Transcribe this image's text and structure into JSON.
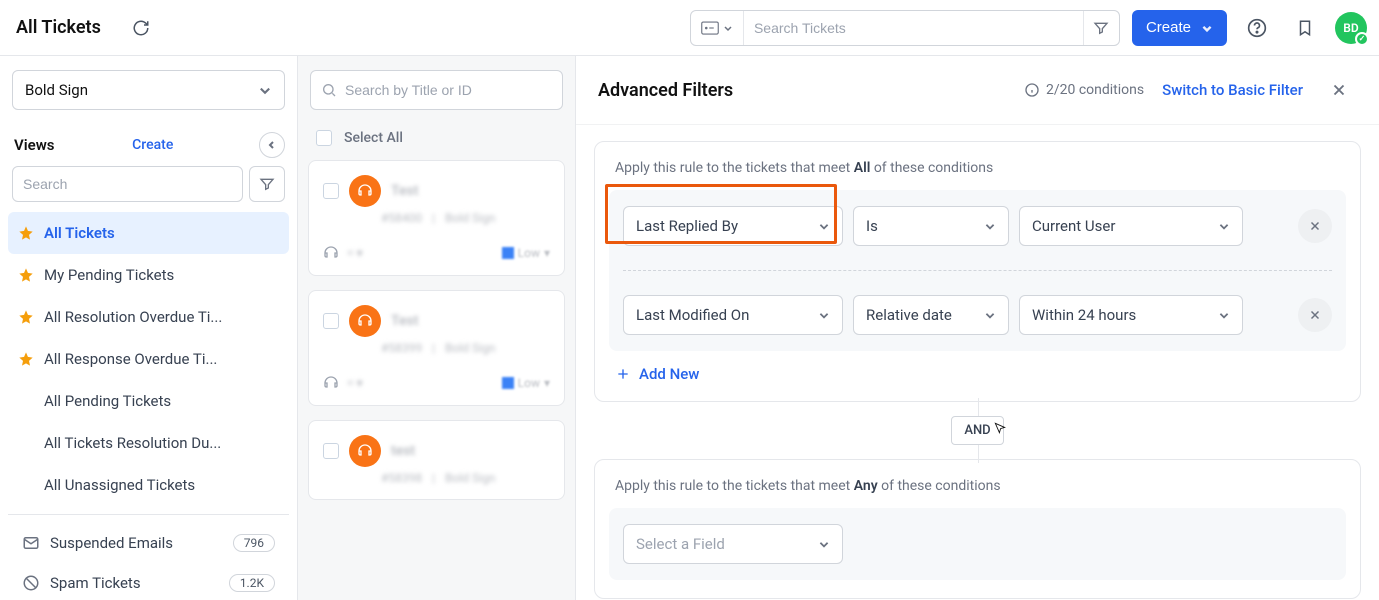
{
  "topbar": {
    "title": "All Tickets",
    "search_placeholder": "Search Tickets",
    "create_label": "Create",
    "avatar_initials": "BD"
  },
  "sidebar": {
    "product": "Bold Sign",
    "views_heading": "Views",
    "create_link": "Create",
    "search_placeholder": "Search",
    "items": [
      {
        "label": "All Tickets",
        "starred": true,
        "active": true
      },
      {
        "label": "My Pending Tickets",
        "starred": true,
        "active": false
      },
      {
        "label": "All Resolution Overdue Ti...",
        "starred": true,
        "active": false
      },
      {
        "label": "All Response Overdue Ti...",
        "starred": true,
        "active": false
      },
      {
        "label": "All Pending Tickets",
        "starred": false,
        "active": false
      },
      {
        "label": "All Tickets Resolution Du...",
        "starred": false,
        "active": false
      },
      {
        "label": "All Unassigned Tickets",
        "starred": false,
        "active": false
      }
    ],
    "special": [
      {
        "label": "Suspended Emails",
        "count": "796",
        "icon": "mail"
      },
      {
        "label": "Spam Tickets",
        "count": "1.2K",
        "icon": "spam"
      }
    ]
  },
  "tickets": {
    "search_placeholder": "Search by Title or ID",
    "select_all": "Select All",
    "cards": [
      {
        "title": "Test",
        "id": "#58400",
        "product": "Bold Sign",
        "priority": "Low"
      },
      {
        "title": "Test",
        "id": "#58399",
        "product": "Bold Sign",
        "priority": "Low"
      },
      {
        "title": "test",
        "id": "#58398",
        "product": "Bold Sign",
        "priority": "Low"
      }
    ]
  },
  "filters": {
    "title": "Advanced Filters",
    "count": "2/20 conditions",
    "switch_link": "Switch to Basic Filter",
    "rule1_caption_pre": "Apply this rule to the tickets that meet ",
    "rule1_caption_bold": "All",
    "rule1_caption_post": " of these conditions",
    "rule2_caption_pre": "Apply this rule to the tickets that meet ",
    "rule2_caption_bold": "Any",
    "rule2_caption_post": " of these conditions",
    "conditions": [
      {
        "field": "Last Replied By",
        "op": "Is",
        "value": "Current User"
      },
      {
        "field": "Last Modified On",
        "op": "Relative date",
        "value": "Within 24 hours"
      }
    ],
    "add_new": "Add New",
    "connector": "AND",
    "rule2_field_placeholder": "Select a Field"
  }
}
